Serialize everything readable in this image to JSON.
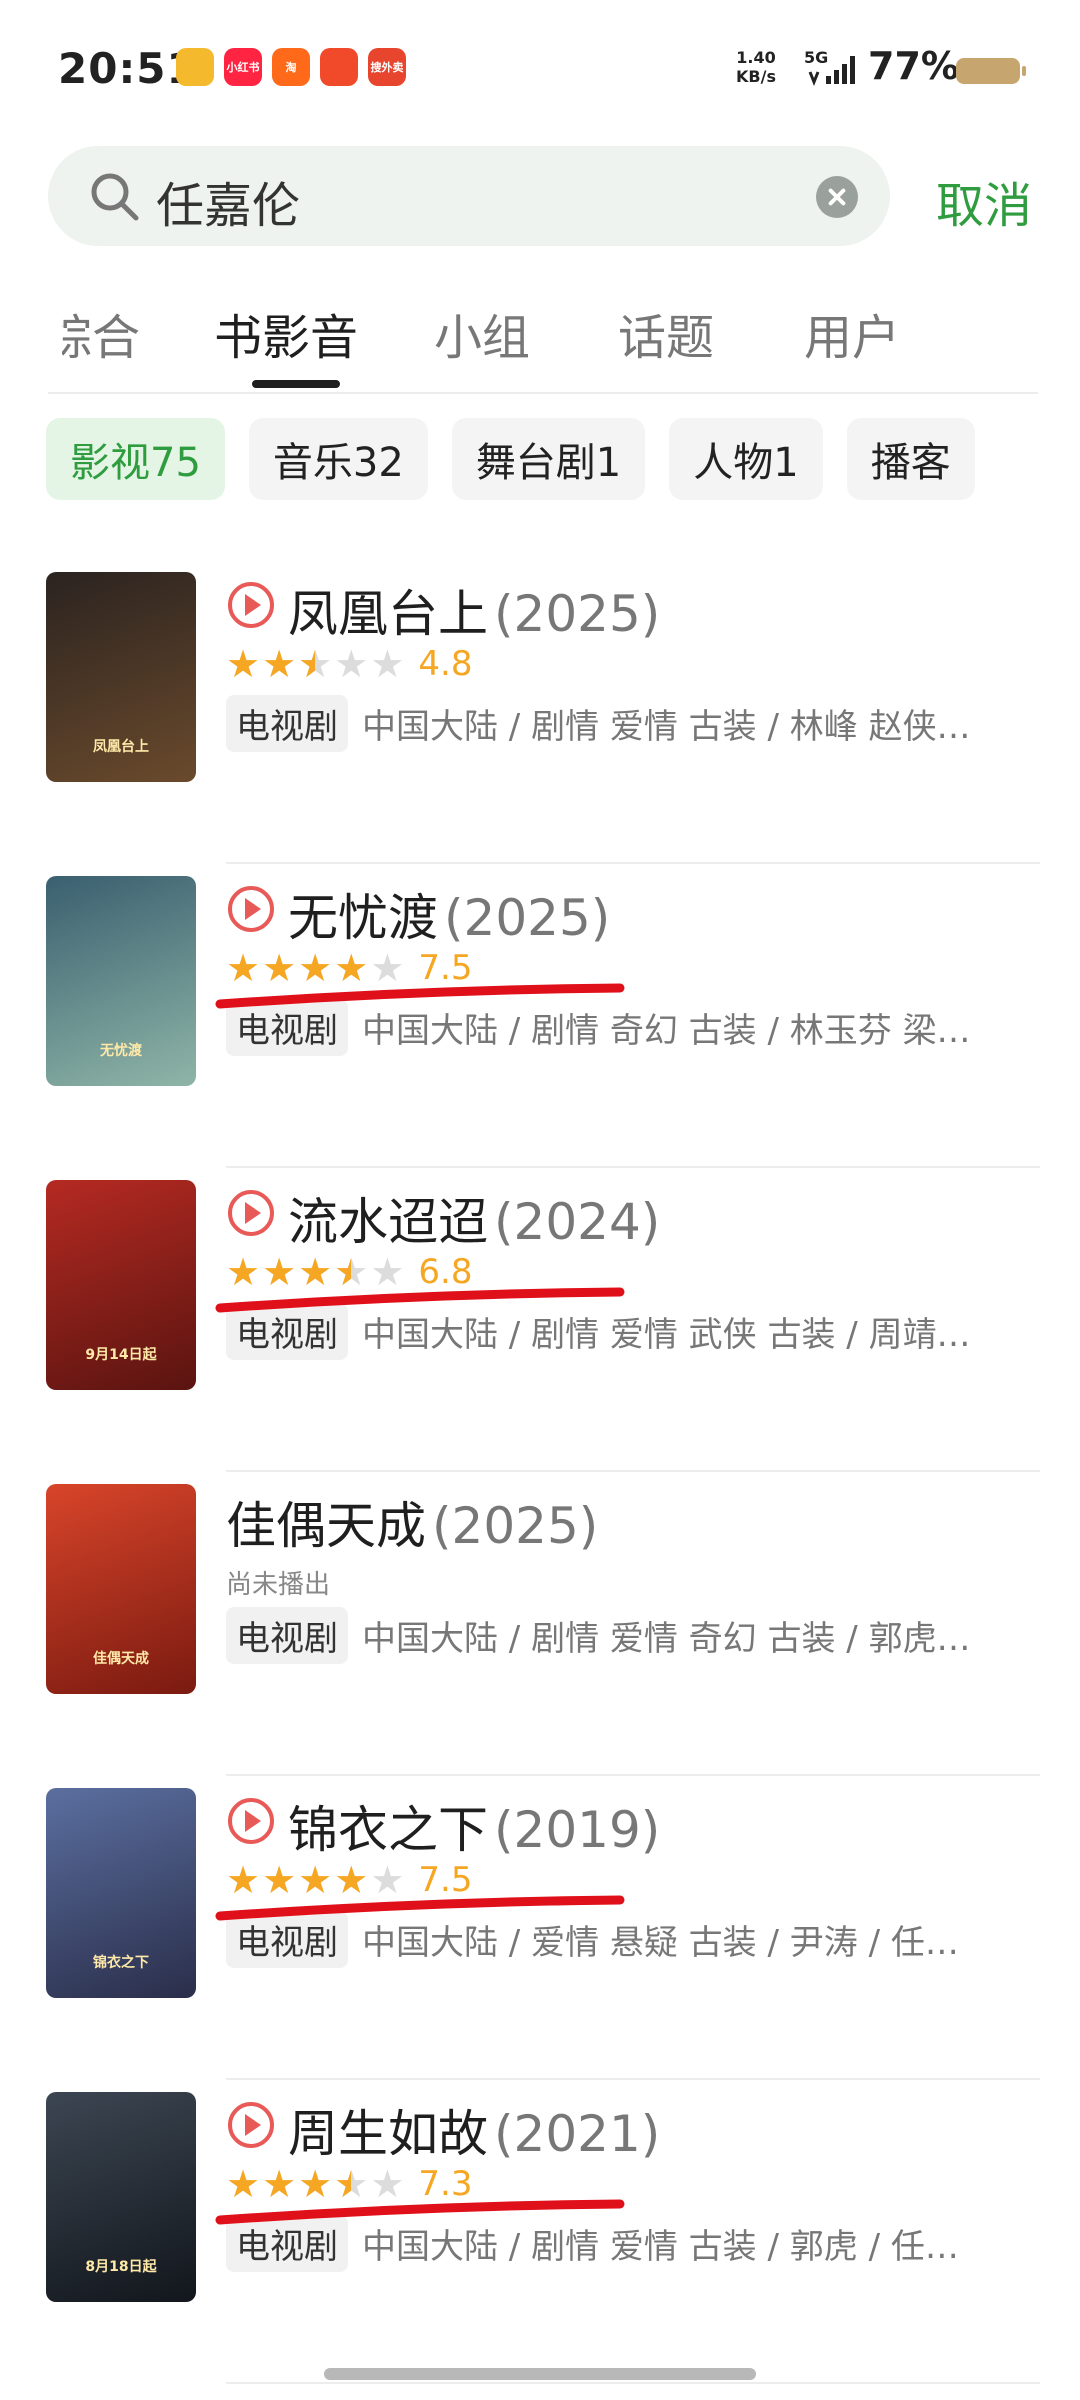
{
  "status_bar": {
    "time": "20:51",
    "app_icons": [
      {
        "name": "weibo-icon",
        "label": "",
        "color": "#f5b92e"
      },
      {
        "name": "xiaohongshu-icon",
        "label": "小红书",
        "color": "#ff2442"
      },
      {
        "name": "taobao-icon",
        "label": "淘",
        "color": "#ff6a1a"
      },
      {
        "name": "meituan-icon",
        "label": "",
        "color": "#f04a2a"
      },
      {
        "name": "waimai-icon",
        "label": "搜外卖",
        "color": "#e8452e"
      }
    ],
    "speed_value": "1.40",
    "speed_unit": "KB/s",
    "network": "5G",
    "battery": "77%"
  },
  "search": {
    "query": "任嘉伦",
    "cancel_label": "取消"
  },
  "tabs": [
    {
      "label": "综合",
      "active": false
    },
    {
      "label": "书影音",
      "active": true
    },
    {
      "label": "小组",
      "active": false
    },
    {
      "label": "话题",
      "active": false
    },
    {
      "label": "用户",
      "active": false
    }
  ],
  "chips": [
    {
      "label": "影视75",
      "active": true
    },
    {
      "label": "音乐32",
      "active": false
    },
    {
      "label": "舞台剧1",
      "active": false
    },
    {
      "label": "人物1",
      "active": false
    },
    {
      "label": "播客",
      "active": false
    }
  ],
  "results": [
    {
      "title": "凤凰台上",
      "year": "(2025)",
      "playable": true,
      "stars": 2.5,
      "score": "4.8",
      "status": "",
      "type": "电视剧",
      "meta": "中国大陆 / 剧情 爱情 古装 / 林峰 赵侠…",
      "poster_caption": "凤凰台上",
      "poster_colors": [
        "#2b2320",
        "#6a4a2c"
      ],
      "annotated": false
    },
    {
      "title": "无忧渡",
      "year": "(2025)",
      "playable": true,
      "stars": 4,
      "score": "7.5",
      "status": "",
      "type": "电视剧",
      "meta": "中国大陆 / 剧情 奇幻 古装 / 林玉芬 梁…",
      "poster_caption": "无忧渡",
      "poster_colors": [
        "#3a5f6f",
        "#8fb5a8"
      ],
      "annotated": true
    },
    {
      "title": "流水迢迢",
      "year": "(2024)",
      "playable": true,
      "stars": 3.5,
      "score": "6.8",
      "status": "",
      "type": "电视剧",
      "meta": "中国大陆 / 剧情 爱情 武侠 古装 / 周靖…",
      "poster_caption": "9月14日起",
      "poster_colors": [
        "#b52a22",
        "#5a1410"
      ],
      "annotated": true
    },
    {
      "title": "佳偶天成",
      "year": "(2025)",
      "playable": false,
      "stars": 0,
      "score": "",
      "status": "尚未播出",
      "type": "电视剧",
      "meta": "中国大陆 / 剧情 爱情 奇幻 古装 / 郭虎…",
      "poster_caption": "佳偶天成",
      "poster_colors": [
        "#d8452a",
        "#7a1a10"
      ],
      "annotated": false
    },
    {
      "title": "锦衣之下",
      "year": "(2019)",
      "playable": true,
      "stars": 4,
      "score": "7.5",
      "status": "",
      "type": "电视剧",
      "meta": "中国大陆 / 爱情 悬疑 古装 / 尹涛 / 任…",
      "poster_caption": "锦衣之下",
      "poster_colors": [
        "#5b6fa0",
        "#2a2e4a"
      ],
      "annotated": true
    },
    {
      "title": "周生如故",
      "year": "(2021)",
      "playable": true,
      "stars": 3.5,
      "score": "7.3",
      "status": "",
      "type": "电视剧",
      "meta": "中国大陆 / 剧情 爱情 古装 / 郭虎 / 任…",
      "poster_caption": "8月18日起",
      "poster_colors": [
        "#3c4652",
        "#12161c"
      ],
      "annotated": true
    }
  ]
}
